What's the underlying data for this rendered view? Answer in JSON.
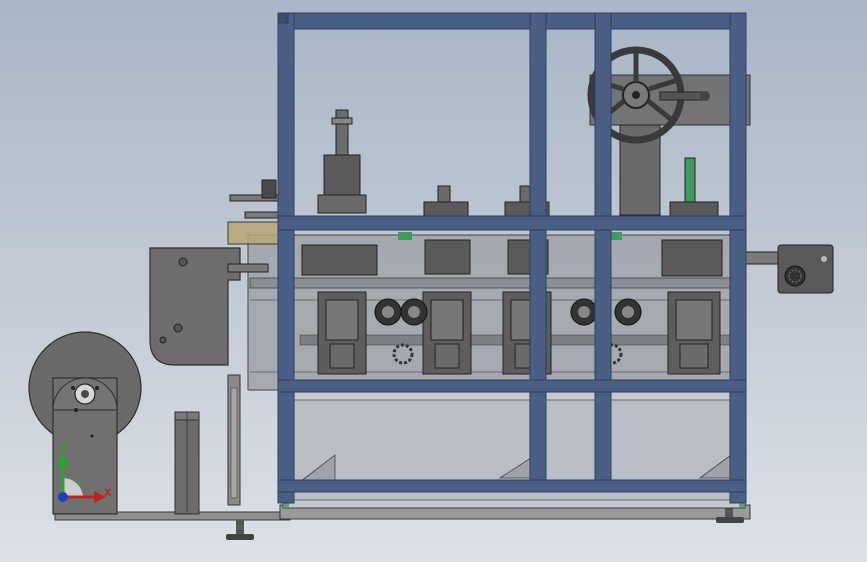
{
  "viewport": {
    "background_top": "#a9b6c6",
    "background_bottom": "#dde1e6"
  },
  "colors": {
    "frame_blue": "#4a5f85",
    "frame_blue_dark": "#2f3f5e",
    "machine_grey": "#6e6e6e",
    "machine_dark": "#4f4f50",
    "machine_light": "#8a8a8a",
    "glass": "#bfc3c8",
    "accent_green": "#3f9a5e"
  },
  "triad": {
    "y_label": "Y",
    "x_label": "X",
    "y_color": "#2aa52a",
    "x_color": "#c42020",
    "z_color": "#1f3fbf"
  }
}
